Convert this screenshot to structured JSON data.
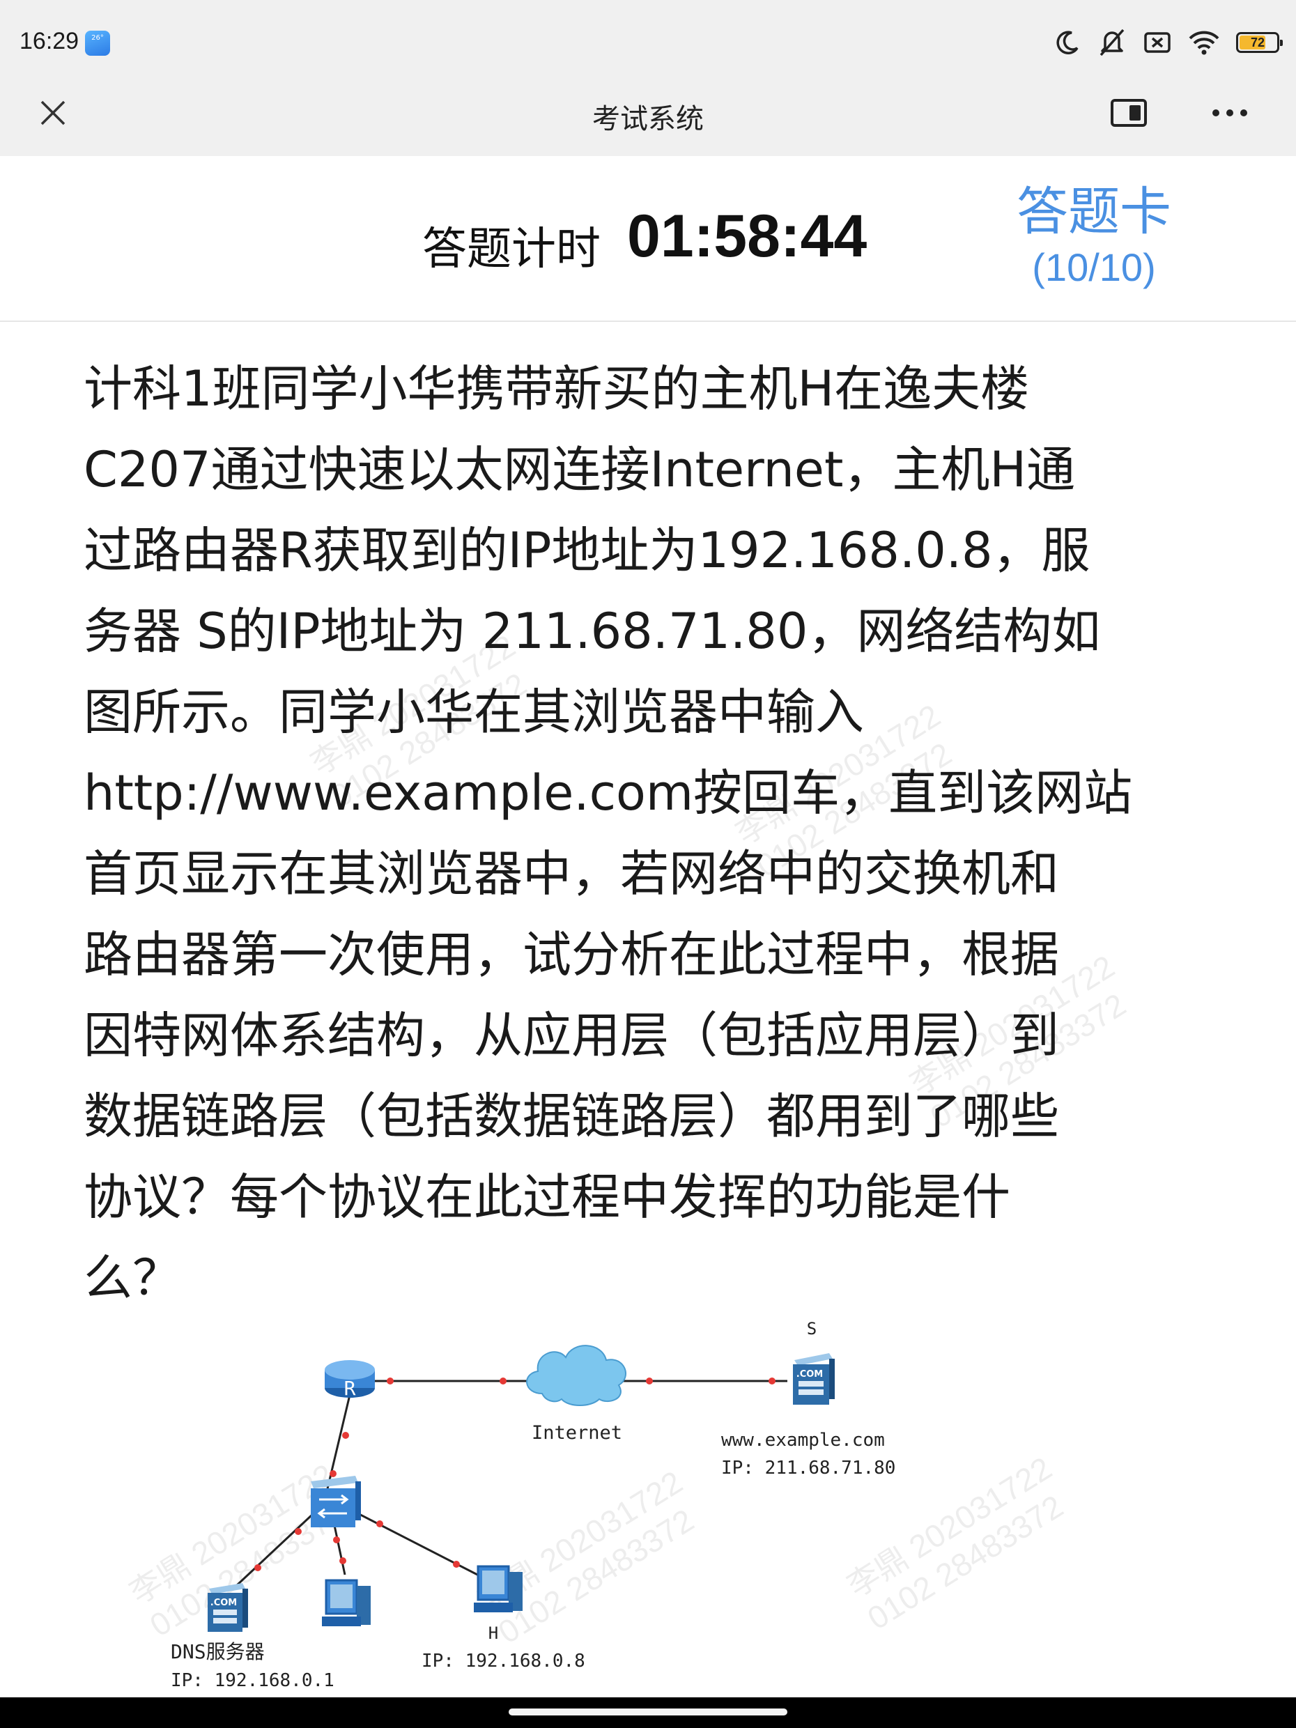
{
  "status_bar": {
    "time": "16:29",
    "weather_badge": "26°",
    "battery_level": "72",
    "battery_fraction": 0.72,
    "icons": [
      "moon-icon",
      "mute-icon",
      "sim-off-icon",
      "wifi-icon",
      "battery-icon"
    ]
  },
  "app": {
    "title": "考试系统",
    "close_icon": "close-icon",
    "split_icon": "split-view-icon",
    "more_icon": "more-icon"
  },
  "timer": {
    "label": "答题计时",
    "value": "01:58:44"
  },
  "answer_card": {
    "label": "答题卡",
    "progress": "(10/10)",
    "color": "#4a90e2"
  },
  "question": {
    "text": "计科1班同学小华携带新买的主机H在逸夫楼\nC207通过快速以太网连接Internet，主机H通\n过路由器R获取到的IP地址为192.168.0.8，服\n务器 S的IP地址为 211.68.71.80，网络结构如\n图所示。同学小华在其浏览器中输入\nhttp://www.example.com按回车，直到该网站\n首页显示在其浏览器中，若网络中的交换机和\n路由器第一次使用，试分析在此过程中，根据\n因特网体系结构，从应用层（包括应用层）到\n数据链路层（包括数据链路层）都用到了哪些\n协议？每个协议在此过程中发挥的功能是什\n么？"
  },
  "diagram": {
    "router_label": "R",
    "cloud_label": "Internet",
    "server_s_label": "S",
    "server_s_badge": ".COM",
    "server_s_host": "www.example.com",
    "server_s_ip": "IP: 211.68.71.80",
    "dns_badge": ".COM",
    "dns_label": "DNS服务器",
    "dns_ip": "IP: 192.168.0.1",
    "host_h_label": "H",
    "host_h_ip": "IP: 192.168.0.8"
  },
  "watermark": {
    "line1": "李鼎 202031722",
    "line2": "0102 28483372"
  }
}
